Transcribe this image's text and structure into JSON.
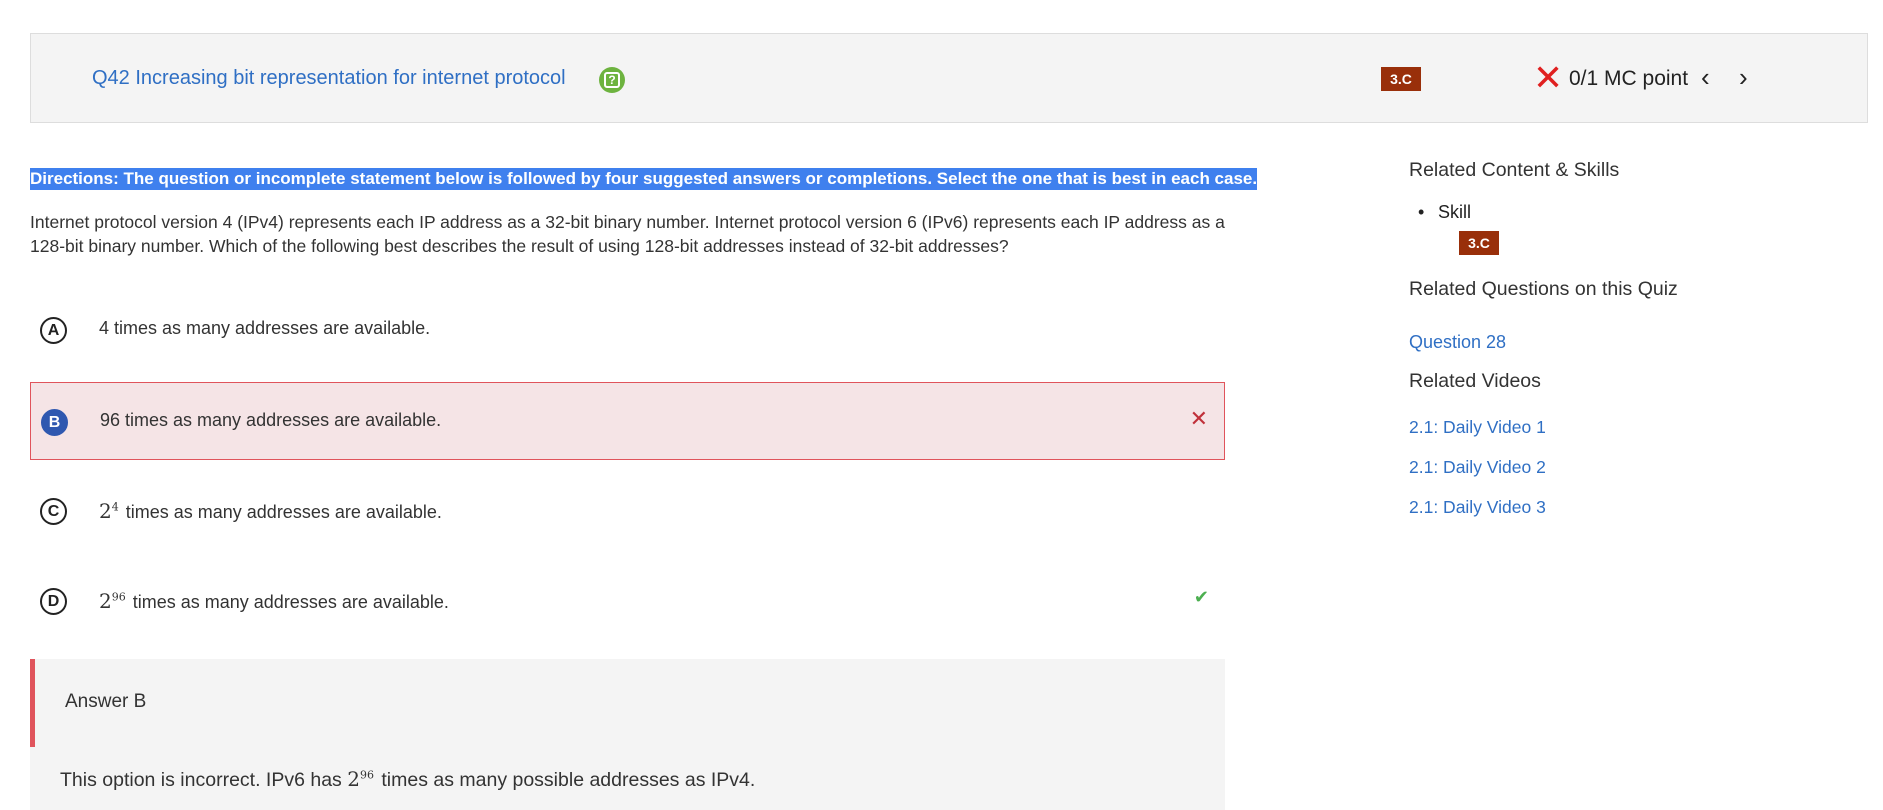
{
  "header": {
    "question_title": "Q42 Increasing bit representation for internet protocol",
    "help_icon": "question-mark-icon",
    "skill_badge": "3.C",
    "score_icon": "red-x-icon",
    "score_text": "0/1 MC point",
    "prev_icon": "‹",
    "next_icon": "›"
  },
  "directions": "Directions: The question or incomplete statement below is followed by four suggested answers or completions. Select the one that is best in each case.",
  "stem": "Internet protocol version 4 (IPv4) represents each IP address as a 32-bit binary number. Internet protocol version 6 (IPv6) represents each IP address as a 128-bit binary number. Which of the following best describes the result of using 128-bit addresses instead of 32-bit addresses?",
  "options": [
    {
      "letter": "A",
      "text": "4 times as many addresses are available."
    },
    {
      "letter": "B",
      "text": "96 times as many addresses are available.",
      "status": "incorrect-selected"
    },
    {
      "letter": "C",
      "base": "2",
      "exp": "4",
      "text": "times as many addresses are available."
    },
    {
      "letter": "D",
      "base": "2",
      "exp": "96",
      "text": "times as many addresses are available.",
      "status": "correct"
    }
  ],
  "answer": {
    "heading": "Answer B",
    "body_before": "This option is incorrect. IPv6 has",
    "base": "2",
    "exp": "96",
    "body_after": "times as many possible addresses as IPv4."
  },
  "sidebar": {
    "related_content_heading": "Related Content & Skills",
    "skill_label": "Skill",
    "skill_badge": "3.C",
    "related_questions_heading": "Related Questions on this Quiz",
    "related_questions": [
      "Question 28"
    ],
    "related_videos_heading": "Related Videos",
    "videos": [
      "2.1: Daily Video 1",
      "2.1: Daily Video 2",
      "2.1: Daily Video 3"
    ]
  },
  "colors": {
    "link_blue": "#2f6fc4",
    "badge_brown": "#992f0a",
    "incorrect_red": "#e0545c",
    "correct_green": "#4caf50",
    "selection_blue": "#3f80ee"
  }
}
